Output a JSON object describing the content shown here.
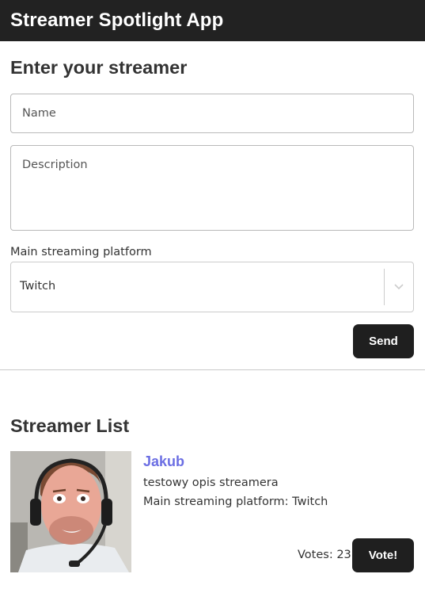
{
  "header": {
    "title": "Streamer Spotlight App"
  },
  "form": {
    "heading": "Enter your streamer",
    "name_placeholder": "Name",
    "description_placeholder": "Description",
    "platform_label": "Main streaming platform",
    "platform_selected": "Twitch",
    "send_label": "Send"
  },
  "list": {
    "heading": "Streamer List",
    "items": [
      {
        "name": "Jakub",
        "description": "testowy opis streamera",
        "platform_text": "Main streaming platform: Twitch",
        "votes_text": "Votes: 23",
        "votes": 23,
        "vote_label": "Vote!"
      }
    ]
  },
  "colors": {
    "header_bg": "#222222",
    "button_bg": "#1f1f1f",
    "link_accent": "#6b6ee3"
  },
  "icons": {
    "select_arrow": "chevron-down-icon"
  }
}
